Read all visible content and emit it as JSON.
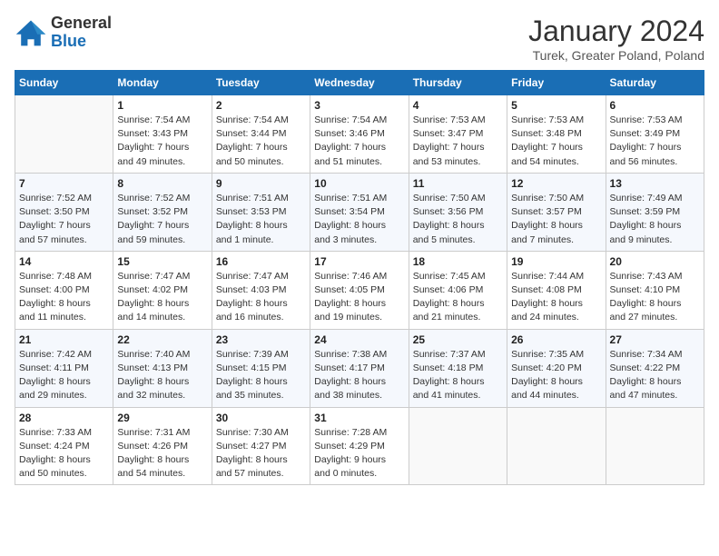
{
  "header": {
    "logo": {
      "general": "General",
      "blue": "Blue"
    },
    "title": "January 2024",
    "subtitle": "Turek, Greater Poland, Poland"
  },
  "weekdays": [
    "Sunday",
    "Monday",
    "Tuesday",
    "Wednesday",
    "Thursday",
    "Friday",
    "Saturday"
  ],
  "weeks": [
    [
      {
        "day": "",
        "info": ""
      },
      {
        "day": "1",
        "info": "Sunrise: 7:54 AM\nSunset: 3:43 PM\nDaylight: 7 hours\nand 49 minutes."
      },
      {
        "day": "2",
        "info": "Sunrise: 7:54 AM\nSunset: 3:44 PM\nDaylight: 7 hours\nand 50 minutes."
      },
      {
        "day": "3",
        "info": "Sunrise: 7:54 AM\nSunset: 3:46 PM\nDaylight: 7 hours\nand 51 minutes."
      },
      {
        "day": "4",
        "info": "Sunrise: 7:53 AM\nSunset: 3:47 PM\nDaylight: 7 hours\nand 53 minutes."
      },
      {
        "day": "5",
        "info": "Sunrise: 7:53 AM\nSunset: 3:48 PM\nDaylight: 7 hours\nand 54 minutes."
      },
      {
        "day": "6",
        "info": "Sunrise: 7:53 AM\nSunset: 3:49 PM\nDaylight: 7 hours\nand 56 minutes."
      }
    ],
    [
      {
        "day": "7",
        "info": "Sunrise: 7:52 AM\nSunset: 3:50 PM\nDaylight: 7 hours\nand 57 minutes."
      },
      {
        "day": "8",
        "info": "Sunrise: 7:52 AM\nSunset: 3:52 PM\nDaylight: 7 hours\nand 59 minutes."
      },
      {
        "day": "9",
        "info": "Sunrise: 7:51 AM\nSunset: 3:53 PM\nDaylight: 8 hours\nand 1 minute."
      },
      {
        "day": "10",
        "info": "Sunrise: 7:51 AM\nSunset: 3:54 PM\nDaylight: 8 hours\nand 3 minutes."
      },
      {
        "day": "11",
        "info": "Sunrise: 7:50 AM\nSunset: 3:56 PM\nDaylight: 8 hours\nand 5 minutes."
      },
      {
        "day": "12",
        "info": "Sunrise: 7:50 AM\nSunset: 3:57 PM\nDaylight: 8 hours\nand 7 minutes."
      },
      {
        "day": "13",
        "info": "Sunrise: 7:49 AM\nSunset: 3:59 PM\nDaylight: 8 hours\nand 9 minutes."
      }
    ],
    [
      {
        "day": "14",
        "info": "Sunrise: 7:48 AM\nSunset: 4:00 PM\nDaylight: 8 hours\nand 11 minutes."
      },
      {
        "day": "15",
        "info": "Sunrise: 7:47 AM\nSunset: 4:02 PM\nDaylight: 8 hours\nand 14 minutes."
      },
      {
        "day": "16",
        "info": "Sunrise: 7:47 AM\nSunset: 4:03 PM\nDaylight: 8 hours\nand 16 minutes."
      },
      {
        "day": "17",
        "info": "Sunrise: 7:46 AM\nSunset: 4:05 PM\nDaylight: 8 hours\nand 19 minutes."
      },
      {
        "day": "18",
        "info": "Sunrise: 7:45 AM\nSunset: 4:06 PM\nDaylight: 8 hours\nand 21 minutes."
      },
      {
        "day": "19",
        "info": "Sunrise: 7:44 AM\nSunset: 4:08 PM\nDaylight: 8 hours\nand 24 minutes."
      },
      {
        "day": "20",
        "info": "Sunrise: 7:43 AM\nSunset: 4:10 PM\nDaylight: 8 hours\nand 27 minutes."
      }
    ],
    [
      {
        "day": "21",
        "info": "Sunrise: 7:42 AM\nSunset: 4:11 PM\nDaylight: 8 hours\nand 29 minutes."
      },
      {
        "day": "22",
        "info": "Sunrise: 7:40 AM\nSunset: 4:13 PM\nDaylight: 8 hours\nand 32 minutes."
      },
      {
        "day": "23",
        "info": "Sunrise: 7:39 AM\nSunset: 4:15 PM\nDaylight: 8 hours\nand 35 minutes."
      },
      {
        "day": "24",
        "info": "Sunrise: 7:38 AM\nSunset: 4:17 PM\nDaylight: 8 hours\nand 38 minutes."
      },
      {
        "day": "25",
        "info": "Sunrise: 7:37 AM\nSunset: 4:18 PM\nDaylight: 8 hours\nand 41 minutes."
      },
      {
        "day": "26",
        "info": "Sunrise: 7:35 AM\nSunset: 4:20 PM\nDaylight: 8 hours\nand 44 minutes."
      },
      {
        "day": "27",
        "info": "Sunrise: 7:34 AM\nSunset: 4:22 PM\nDaylight: 8 hours\nand 47 minutes."
      }
    ],
    [
      {
        "day": "28",
        "info": "Sunrise: 7:33 AM\nSunset: 4:24 PM\nDaylight: 8 hours\nand 50 minutes."
      },
      {
        "day": "29",
        "info": "Sunrise: 7:31 AM\nSunset: 4:26 PM\nDaylight: 8 hours\nand 54 minutes."
      },
      {
        "day": "30",
        "info": "Sunrise: 7:30 AM\nSunset: 4:27 PM\nDaylight: 8 hours\nand 57 minutes."
      },
      {
        "day": "31",
        "info": "Sunrise: 7:28 AM\nSunset: 4:29 PM\nDaylight: 9 hours\nand 0 minutes."
      },
      {
        "day": "",
        "info": ""
      },
      {
        "day": "",
        "info": ""
      },
      {
        "day": "",
        "info": ""
      }
    ]
  ]
}
